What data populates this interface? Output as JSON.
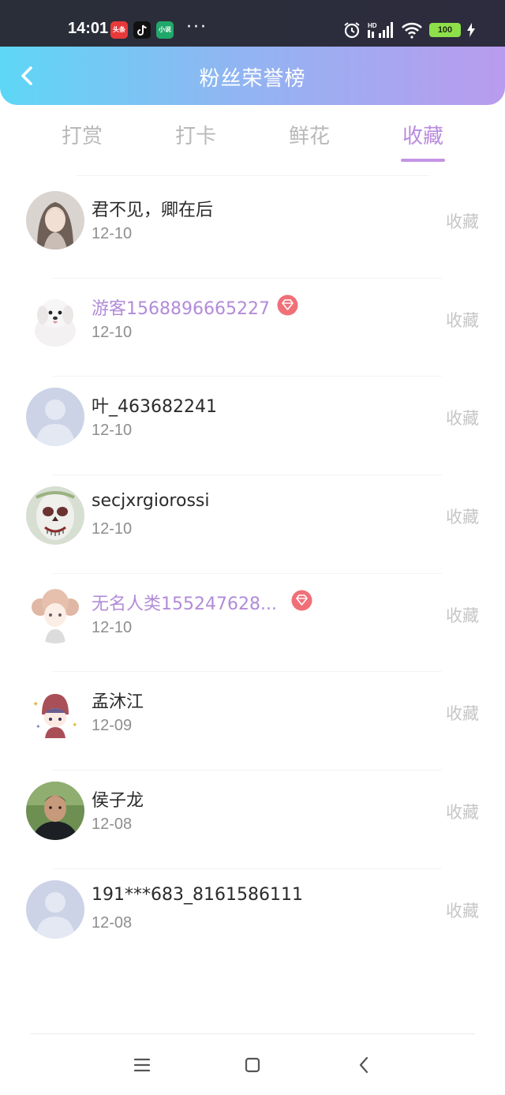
{
  "status_bar": {
    "time": "14:01",
    "apps": [
      "头条",
      "抖音",
      "小说"
    ],
    "more": "···",
    "network": "HD",
    "battery": "100"
  },
  "header": {
    "title": "粉丝荣誉榜",
    "back_icon": "chevron-left-icon"
  },
  "tabs": [
    {
      "label": "打赏",
      "active": false
    },
    {
      "label": "打卡",
      "active": false
    },
    {
      "label": "鲜花",
      "active": false
    },
    {
      "label": "收藏",
      "active": true
    }
  ],
  "fans": [
    {
      "name": "君不见，卿在后",
      "date": "12-10",
      "action": "收藏",
      "vip": false,
      "avatar": "girl-photo"
    },
    {
      "name": "游客1568896665227",
      "date": "12-10",
      "action": "收藏",
      "vip": true,
      "avatar": "white-dog"
    },
    {
      "name": "叶_463682241",
      "date": "12-10",
      "action": "收藏",
      "vip": false,
      "avatar": "default-person"
    },
    {
      "name": "secjxrgiorossi",
      "date": "12-10",
      "action": "收藏",
      "vip": false,
      "avatar": "skull-face"
    },
    {
      "name": "无名人类155247628...",
      "date": "12-10",
      "action": "收藏",
      "vip": true,
      "avatar": "anime-girl"
    },
    {
      "name": "孟沐江",
      "date": "12-09",
      "action": "收藏",
      "vip": false,
      "avatar": "cartoon-girl"
    },
    {
      "name": "侯子龙",
      "date": "12-08",
      "action": "收藏",
      "vip": false,
      "avatar": "man-photo"
    },
    {
      "name": "191***683_8161586111",
      "date": "12-08",
      "action": "收藏",
      "vip": false,
      "avatar": "default-person"
    }
  ],
  "colors": {
    "accent": "#b98bde",
    "header_gradient_start": "#5ed7f6",
    "header_gradient_end": "#b99bee",
    "vip_badge": "#f07078"
  },
  "nav_bar": [
    "menu-icon",
    "home-square-icon",
    "back-triangle-icon"
  ]
}
